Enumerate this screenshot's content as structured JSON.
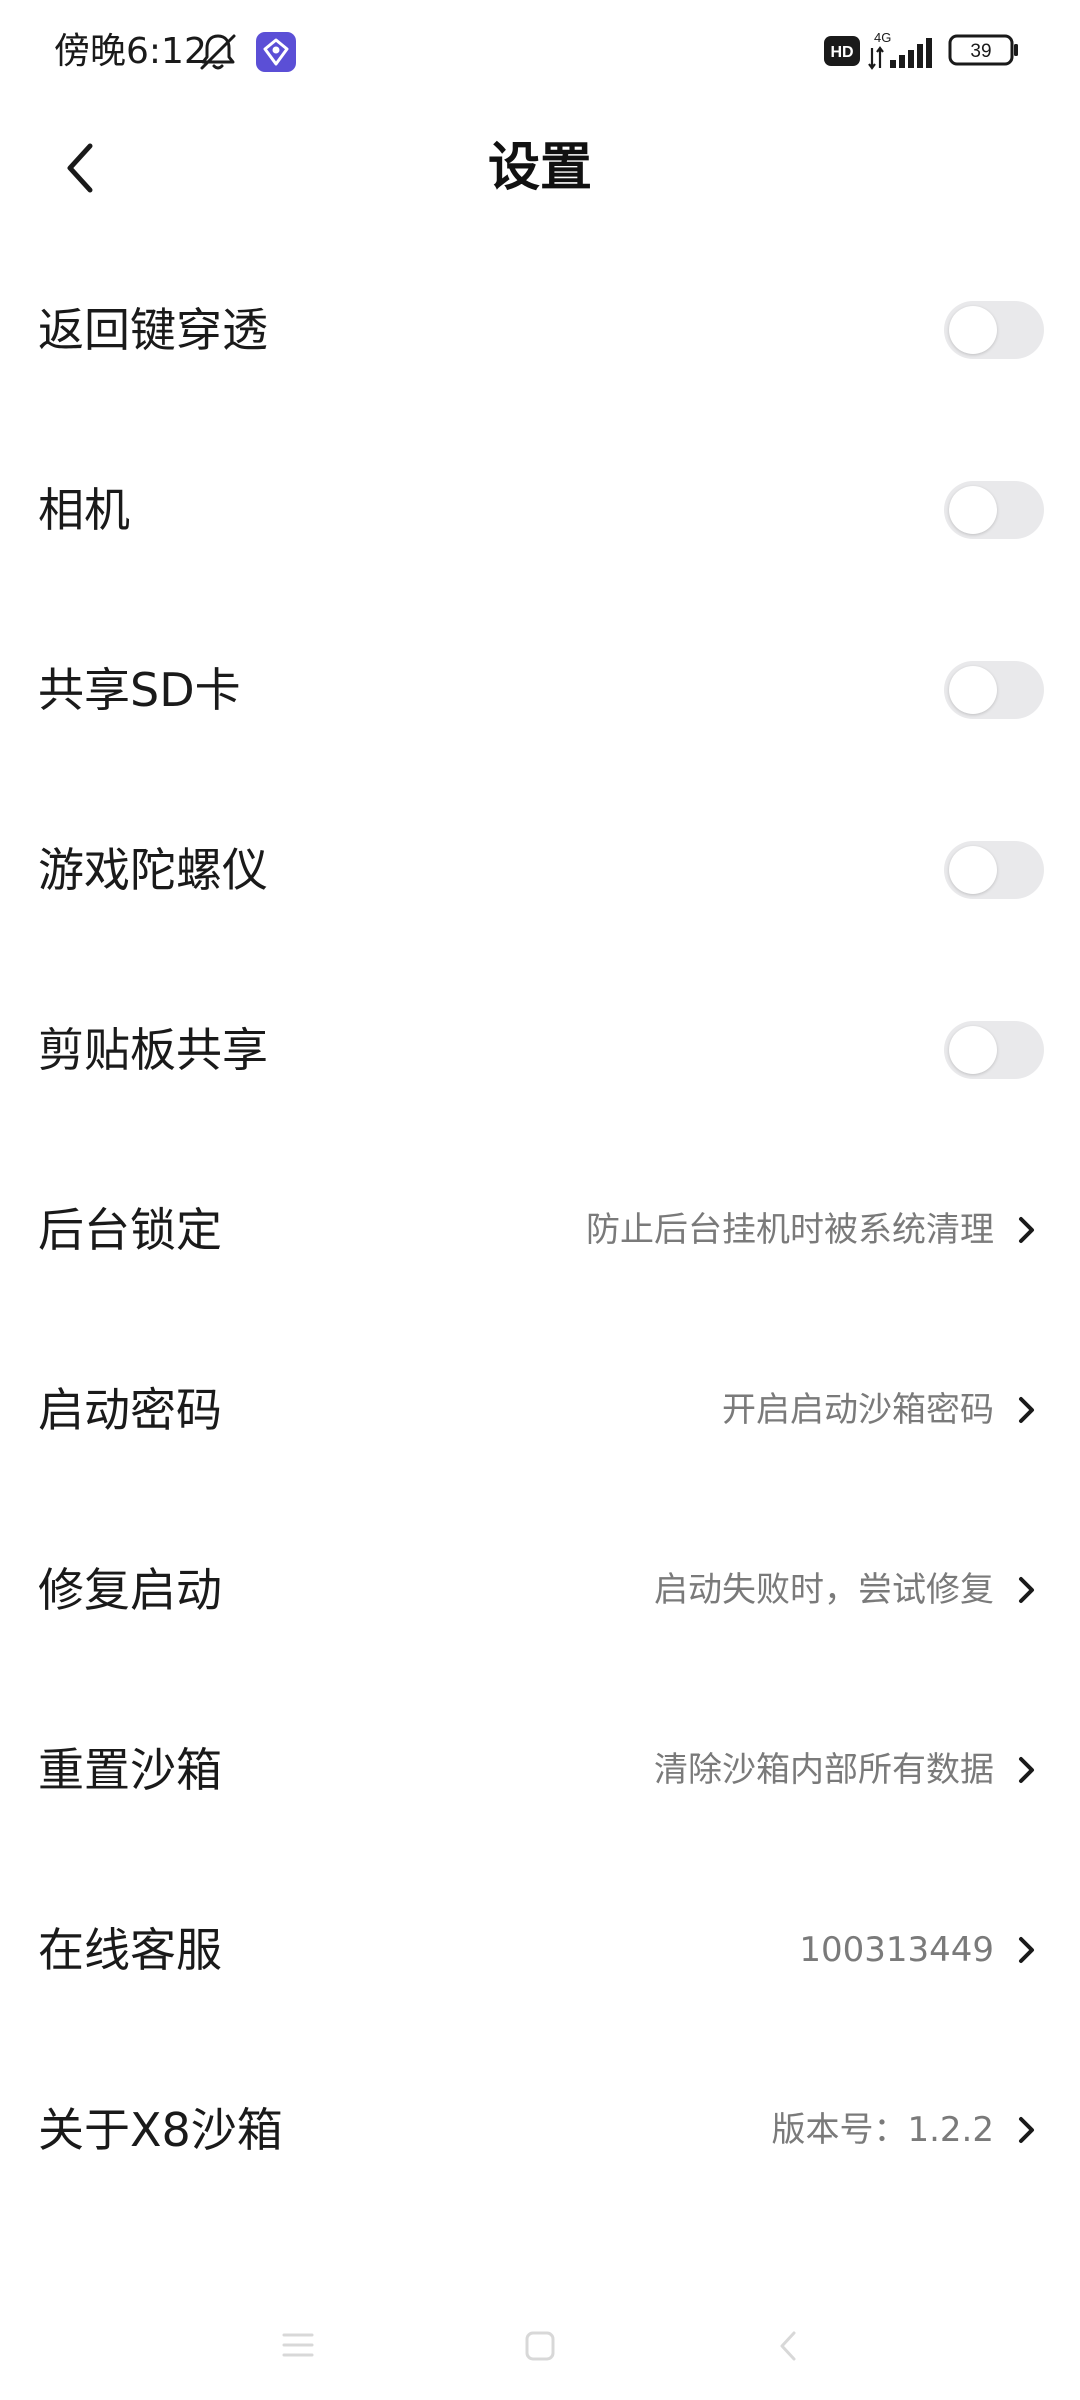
{
  "status_bar": {
    "time": "傍晚6:12",
    "hd_label": "HD",
    "network_label": "4G",
    "battery_level": "39",
    "icons": [
      "bell-off-icon",
      "app-notification-icon",
      "hd-icon",
      "signal-icon",
      "battery-icon"
    ]
  },
  "header": {
    "title": "设置",
    "back_icon": "chevron-left-icon"
  },
  "settings": {
    "toggles": [
      {
        "label": "返回键穿透",
        "enabled": false
      },
      {
        "label": "相机",
        "enabled": false
      },
      {
        "label": "共享SD卡",
        "enabled": false
      },
      {
        "label": "游戏陀螺仪",
        "enabled": false
      },
      {
        "label": "剪贴板共享",
        "enabled": false
      }
    ],
    "links": [
      {
        "label": "后台锁定",
        "value": "防止后台挂机时被系统清理"
      },
      {
        "label": "启动密码",
        "value": "开启启动沙箱密码"
      },
      {
        "label": "修复启动",
        "value": "启动失败时，尝试修复"
      },
      {
        "label": "重置沙箱",
        "value": "清除沙箱内部所有数据"
      },
      {
        "label": "在线客服",
        "value": "100313449"
      },
      {
        "label": "关于X8沙箱",
        "value": "版本号：1.2.2"
      }
    ]
  },
  "nav_bar": {
    "icons": [
      "menu-icon",
      "home-icon",
      "back-icon"
    ]
  },
  "colors": {
    "text_primary": "#1a1a1a",
    "text_secondary": "#7a7a7a",
    "toggle_off": "#e9e9eb",
    "app_icon_accent": "#5b4fd6"
  }
}
